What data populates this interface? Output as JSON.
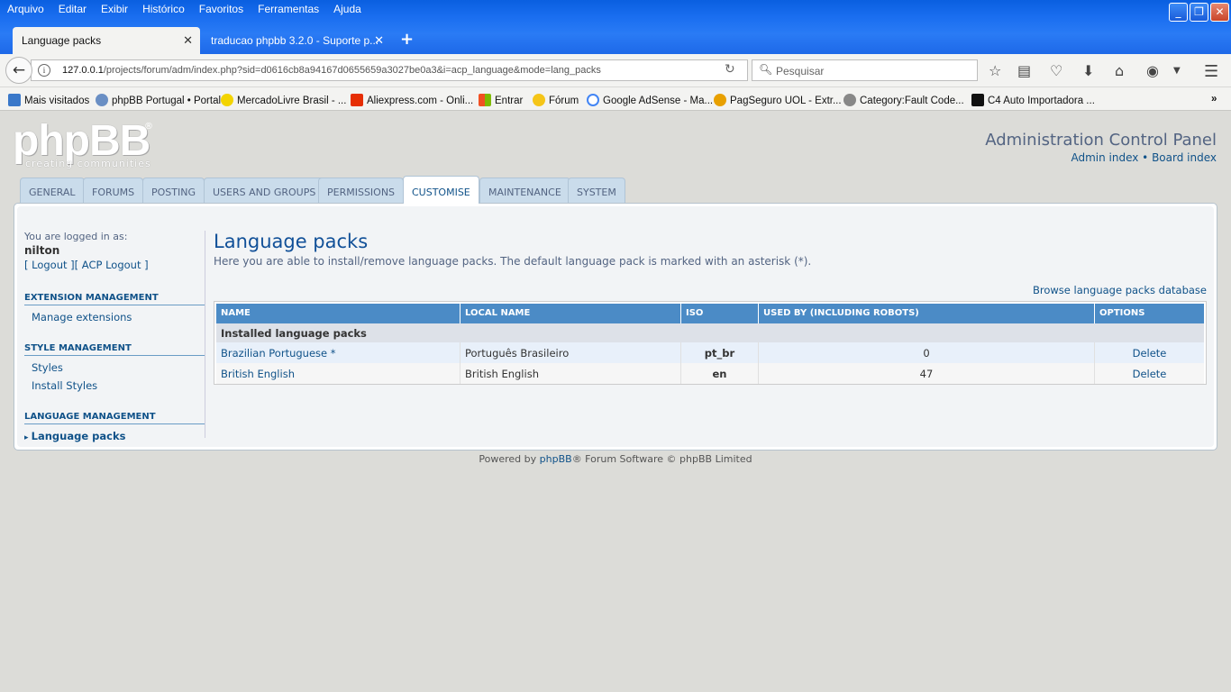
{
  "browser": {
    "menu": [
      "Arquivo",
      "Editar",
      "Exibir",
      "Histórico",
      "Favoritos",
      "Ferramentas",
      "Ajuda"
    ],
    "tabs": [
      {
        "title": "Language packs"
      },
      {
        "title": "traducao phpbb 3.2.0 - Suporte p..."
      }
    ],
    "url_host": "127.0.0.1",
    "url_rest": "/projects/forum/adm/index.php?sid=d0616cb8a94167d0655659a3027be0a3&i=acp_language&mode=lang_packs",
    "search_placeholder": "Pesquisar",
    "bookmarks": [
      {
        "label": "Mais visitados",
        "icon": "gear-icon",
        "color": "#3a78c9"
      },
      {
        "label": "phpBB Portugal • Portal",
        "icon": "people-icon",
        "color": "#6a8fc4"
      },
      {
        "label": "MercadoLivre Brasil - ...",
        "icon": "handshake-icon",
        "color": "#f3d400"
      },
      {
        "label": "Aliexpress.com - Onli...",
        "icon": "cart-icon",
        "color": "#e62e04"
      },
      {
        "label": "Entrar",
        "icon": "windows-icon",
        "color": "#0078d7"
      },
      {
        "label": "Fórum",
        "icon": "heart-icon",
        "color": "#f5c518"
      },
      {
        "label": "Google AdSense - Ma...",
        "icon": "google-icon",
        "color": "#4285f4"
      },
      {
        "label": "PagSeguro UOL - Extr...",
        "icon": "pagseguro-icon",
        "color": "#e8a000"
      },
      {
        "label": "Category:Fault Code...",
        "icon": "globe-icon",
        "color": "#888888"
      },
      {
        "label": "C4 Auto Importadora ...",
        "icon": "c4-icon",
        "color": "#111111"
      }
    ]
  },
  "header": {
    "logo_text": "phpBB",
    "logo_tagline": "creating   communities",
    "acp_title": "Administration Control Panel",
    "admin_index": "Admin index",
    "separator": "•",
    "board_index": "Board index"
  },
  "tabs": [
    "General",
    "Forums",
    "Posting",
    "Users and Groups",
    "Permissions",
    "Customise",
    "Maintenance",
    "System"
  ],
  "active_tab": "Customise",
  "sidebar": {
    "logged_in_label": "You are logged in as:",
    "username": "nilton",
    "logout_links": "[ Logout ][ ACP Logout ]",
    "sections": [
      {
        "title": "Extension management",
        "items": [
          "Manage extensions"
        ]
      },
      {
        "title": "Style management",
        "items": [
          "Styles",
          "Install Styles"
        ]
      },
      {
        "title": "Language management",
        "items": [
          "Language packs"
        ]
      }
    ]
  },
  "main": {
    "title": "Language packs",
    "description": "Here you are able to install/remove language packs. The default language pack is marked with an asterisk (*).",
    "browse_link": "Browse language packs database",
    "columns": [
      "Name",
      "Local name",
      "ISO",
      "Used by (including robots)",
      "Options"
    ],
    "group_label": "Installed language packs",
    "rows": [
      {
        "name": "Brazilian Portuguese *",
        "local": "Português Brasileiro",
        "iso": "pt_br",
        "used": "0",
        "option": "Delete"
      },
      {
        "name": "British English",
        "local": "British English",
        "iso": "en",
        "used": "47",
        "option": "Delete"
      }
    ]
  },
  "footer": {
    "pre": "Powered by ",
    "link": "phpBB",
    "post": "® Forum Software © phpBB Limited"
  }
}
